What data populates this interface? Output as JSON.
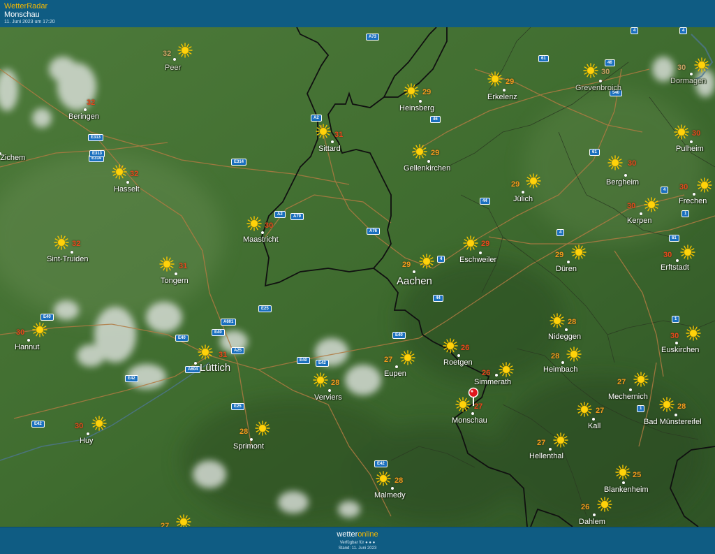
{
  "header": {
    "brand": "WetterRadar",
    "location": "Monschau",
    "timestamp": "11. Juni 2023 um 17:20"
  },
  "footer": {
    "logo_part1": "wetter",
    "logo_part2": "online",
    "available": "Verfügbar für",
    "stand": "Stand: 11. Juni 2023"
  },
  "colors": {
    "temp_orange": "#f29a1d",
    "temp_red": "#e8481c",
    "sign_blue": "#1a6fbe",
    "header_blue": "#0f5c83",
    "brand_yellow": "#f5b800",
    "map_green": "#3e6b2e",
    "pin_red": "#e0171d"
  },
  "selected_location": {
    "name": "Monschau",
    "icon": "location-pin-icon"
  },
  "weather_icon": "sun-icon",
  "cities": [
    {
      "name": "Peer",
      "temp": 32,
      "dim": true
    },
    {
      "name": "Beringen",
      "temp": 32
    },
    {
      "name": "el-Zichem",
      "temp": null
    },
    {
      "name": "Hasselt",
      "temp": 32
    },
    {
      "name": "Sint-Truiden",
      "temp": 32
    },
    {
      "name": "Tongern",
      "temp": 31
    },
    {
      "name": "Hannut",
      "temp": 30
    },
    {
      "name": "Lüttich",
      "temp": 31
    },
    {
      "name": "Huy",
      "temp": 30
    },
    {
      "name": "Sprimont",
      "temp": 28
    },
    {
      "name": "Verviers",
      "temp": 28
    },
    {
      "name": "Malmedy",
      "temp": 28
    },
    {
      "name": "Sittard",
      "temp": 31
    },
    {
      "name": "Maastricht",
      "temp": 30
    },
    {
      "name": "Heinsberg",
      "temp": 29
    },
    {
      "name": "Gellenkirchen",
      "temp": 29
    },
    {
      "name": "Aachen",
      "temp": 29
    },
    {
      "name": "Eupen",
      "temp": 27
    },
    {
      "name": "Roetgen",
      "temp": 26
    },
    {
      "name": "Simmerath",
      "temp": 26
    },
    {
      "name": "Monschau",
      "temp": 27
    },
    {
      "name": "Erkelenz",
      "temp": 29
    },
    {
      "name": "Jülich",
      "temp": 29
    },
    {
      "name": "Eschweiler",
      "temp": 29
    },
    {
      "name": "Düren",
      "temp": 29
    },
    {
      "name": "Nideggen",
      "temp": 28
    },
    {
      "name": "Heimbach",
      "temp": 28
    },
    {
      "name": "Hellenthal",
      "temp": 27
    },
    {
      "name": "Kall",
      "temp": 27
    },
    {
      "name": "Mechernich",
      "temp": 27
    },
    {
      "name": "Grevenbroich",
      "temp": 30,
      "dim": true
    },
    {
      "name": "Bergheim",
      "temp": 30
    },
    {
      "name": "Kerpen",
      "temp": 30
    },
    {
      "name": "Erftstadt",
      "temp": 30
    },
    {
      "name": "Pulheim",
      "temp": 30
    },
    {
      "name": "Frechen",
      "temp": 30
    },
    {
      "name": "Dormagen",
      "temp": 30,
      "dim": true
    },
    {
      "name": "Euskirchen",
      "temp": 30
    },
    {
      "name": "Bad Münstereifel",
      "temp": 28
    },
    {
      "name": "Blankenheim",
      "temp": 25
    },
    {
      "name": "Dahlem",
      "temp": 26
    },
    {
      "name": "",
      "temp": 27
    }
  ],
  "road_signs": [
    "A73",
    "A2",
    "A2",
    "A79",
    "A76",
    "E314",
    "E313",
    "E314",
    "E313",
    "E40",
    "E40",
    "E40",
    "E40",
    "E42",
    "E42",
    "E42",
    "E42",
    "E25",
    "E25",
    "A601",
    "A25",
    "A604",
    "E40",
    "4",
    "4",
    "4",
    "44",
    "44",
    "46",
    "46",
    "61",
    "61",
    "61",
    "540",
    "1",
    "1",
    "1",
    "4",
    "4"
  ]
}
